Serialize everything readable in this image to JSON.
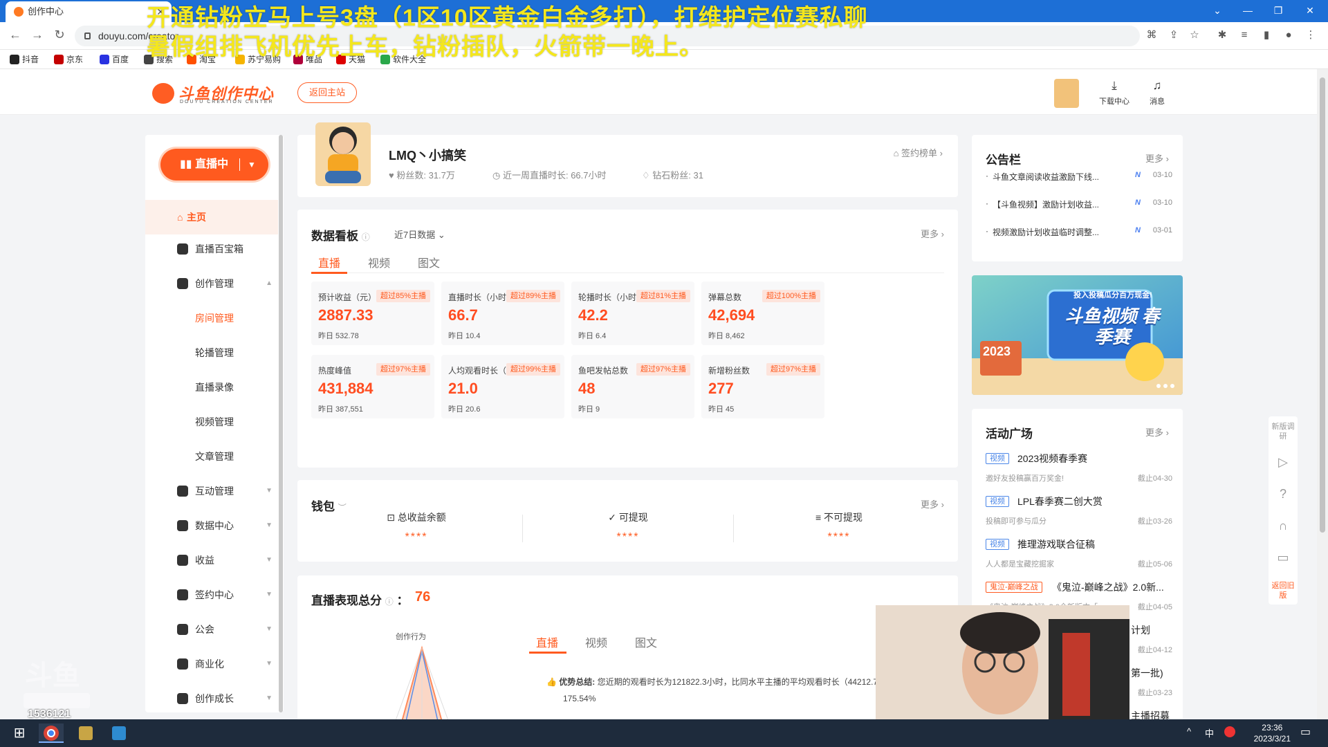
{
  "browser": {
    "tab_title": "创作中心",
    "url": "douyu.com/creator"
  },
  "bookmarks": [
    "抖音",
    "京东",
    "百度",
    "搜索",
    "淘宝",
    "苏宁易购",
    "唯品",
    "天猫",
    "软件大全"
  ],
  "overlay": {
    "line1": "开通钻粉立马上号3盘（1区10区黄金白金多打），打维护定位赛私聊",
    "line2": "暑假组排飞机优先上车，钻粉插队，火箭带一晚上。"
  },
  "header": {
    "logo_text": "斗鱼创作中心",
    "logo_sub": "DOUYU CREATION CENTER",
    "back_home": "返回主站",
    "download": "下载中心",
    "messages": "消息"
  },
  "sidebar": {
    "live_label": "直播中",
    "home": "主页",
    "items": [
      "直播百宝箱",
      "创作管理",
      "互动管理",
      "数据中心",
      "收益",
      "签约中心",
      "公会",
      "商业化",
      "创作成长"
    ],
    "sub": [
      "房间管理",
      "轮播管理",
      "直播录像",
      "视频管理",
      "文章管理"
    ]
  },
  "profile": {
    "name": "LMQ丶小搞笑",
    "fans": "粉丝数: 31.7万",
    "week_hours": "近一周直播时长: 66.7小时",
    "diamond_fans": "钻石粉丝: 31",
    "sign_rank": "签约榜单"
  },
  "dashboard": {
    "title": "数据看板",
    "range": "近7日数据",
    "more": "更多",
    "tabs": [
      "直播",
      "视频",
      "图文"
    ],
    "metrics": [
      {
        "label": "预计收益（元）",
        "badge": "超过85%主播",
        "value": "2887.33",
        "yesterday": "昨日 532.78"
      },
      {
        "label": "直播时长（小时）",
        "badge": "超过89%主播",
        "value": "66.7",
        "yesterday": "昨日 10.4"
      },
      {
        "label": "轮播时长（小时）",
        "badge": "超过81%主播",
        "value": "42.2",
        "yesterday": "昨日 6.4"
      },
      {
        "label": "弹幕总数",
        "badge": "超过100%主播",
        "value": "42,694",
        "yesterday": "昨日 8,462"
      },
      {
        "label": "热度峰值",
        "badge": "超过97%主播",
        "value": "431,884",
        "yesterday": "昨日 387,551"
      },
      {
        "label": "人均观看时长（分钟）",
        "badge": "超过99%主播",
        "value": "21.0",
        "yesterday": "昨日 20.6"
      },
      {
        "label": "鱼吧发帖总数",
        "badge": "超过97%主播",
        "value": "48",
        "yesterday": "昨日 9"
      },
      {
        "label": "新增粉丝数",
        "badge": "超过97%主播",
        "value": "277",
        "yesterday": "昨日 45"
      }
    ]
  },
  "wallet": {
    "title": "钱包",
    "more": "更多",
    "cols": [
      {
        "label": "总收益余额",
        "value": "****"
      },
      {
        "label": "可提现",
        "value": "****"
      },
      {
        "label": "不可提现",
        "value": "****"
      }
    ]
  },
  "score": {
    "title": "直播表现总分",
    "value": "76",
    "radar_label": "创作行为",
    "tabs": [
      "直播",
      "视频",
      "图文"
    ],
    "adv_label": "优势总结:",
    "adv_text": "您近期的观看时长为121822.3小时，比同水平主播的平均观看时长（44212.7",
    "adv_pct": "175.54%"
  },
  "notice": {
    "title": "公告栏",
    "more": "更多",
    "items": [
      {
        "text": "斗鱼文章阅读收益激励下线...",
        "badge": "N",
        "date": "03-10"
      },
      {
        "text": "【斗鱼视频】激励计划收益...",
        "badge": "N",
        "date": "03-10"
      },
      {
        "text": "视频激励计划收益临时调整...",
        "badge": "N",
        "date": "03-01"
      }
    ]
  },
  "banner": {
    "caption": "投入投稿瓜分百万现金!",
    "title": "斗鱼视频 春季赛",
    "year": "2023"
  },
  "activity": {
    "title": "活动广场",
    "more": "更多",
    "items": [
      {
        "tag": "视频",
        "tag_color": "blue",
        "title": "2023视频春季赛",
        "sub": "邀好友投稿赢百万奖金!",
        "date": "截止04-30"
      },
      {
        "tag": "视频",
        "tag_color": "blue",
        "title": "LPL春季赛二创大赏",
        "sub": "投稿即可参与瓜分",
        "date": "截止03-26"
      },
      {
        "tag": "视频",
        "tag_color": "blue",
        "title": "推理游戏联合征稿",
        "sub": "人人都是宝藏挖掘家",
        "date": "截止05-06"
      },
      {
        "tag": "鬼泣-巅峰之战",
        "tag_color": "red",
        "title": "《鬼泣-巅峰之战》2.0新...",
        "sub": "《鬼泣-巅峰之战》2.0全新版本「",
        "date": "截止04-05"
      },
      {
        "tag": "",
        "tag_color": "blue",
        "title": "计划",
        "sub": "",
        "date": "截止04-12"
      },
      {
        "tag": "",
        "tag_color": "blue",
        "title": "第一批)",
        "sub": "",
        "date": "截止03-23"
      },
      {
        "tag": "",
        "tag_color": "blue",
        "title": "主播招募",
        "sub": "",
        "date": ""
      }
    ]
  },
  "float": {
    "survey": "新版调研",
    "old_version": "返回旧版"
  },
  "stream": {
    "room_id": "1536121"
  },
  "taskbar": {
    "ime": "中",
    "time": "23:36",
    "date": "2023/3/21"
  }
}
